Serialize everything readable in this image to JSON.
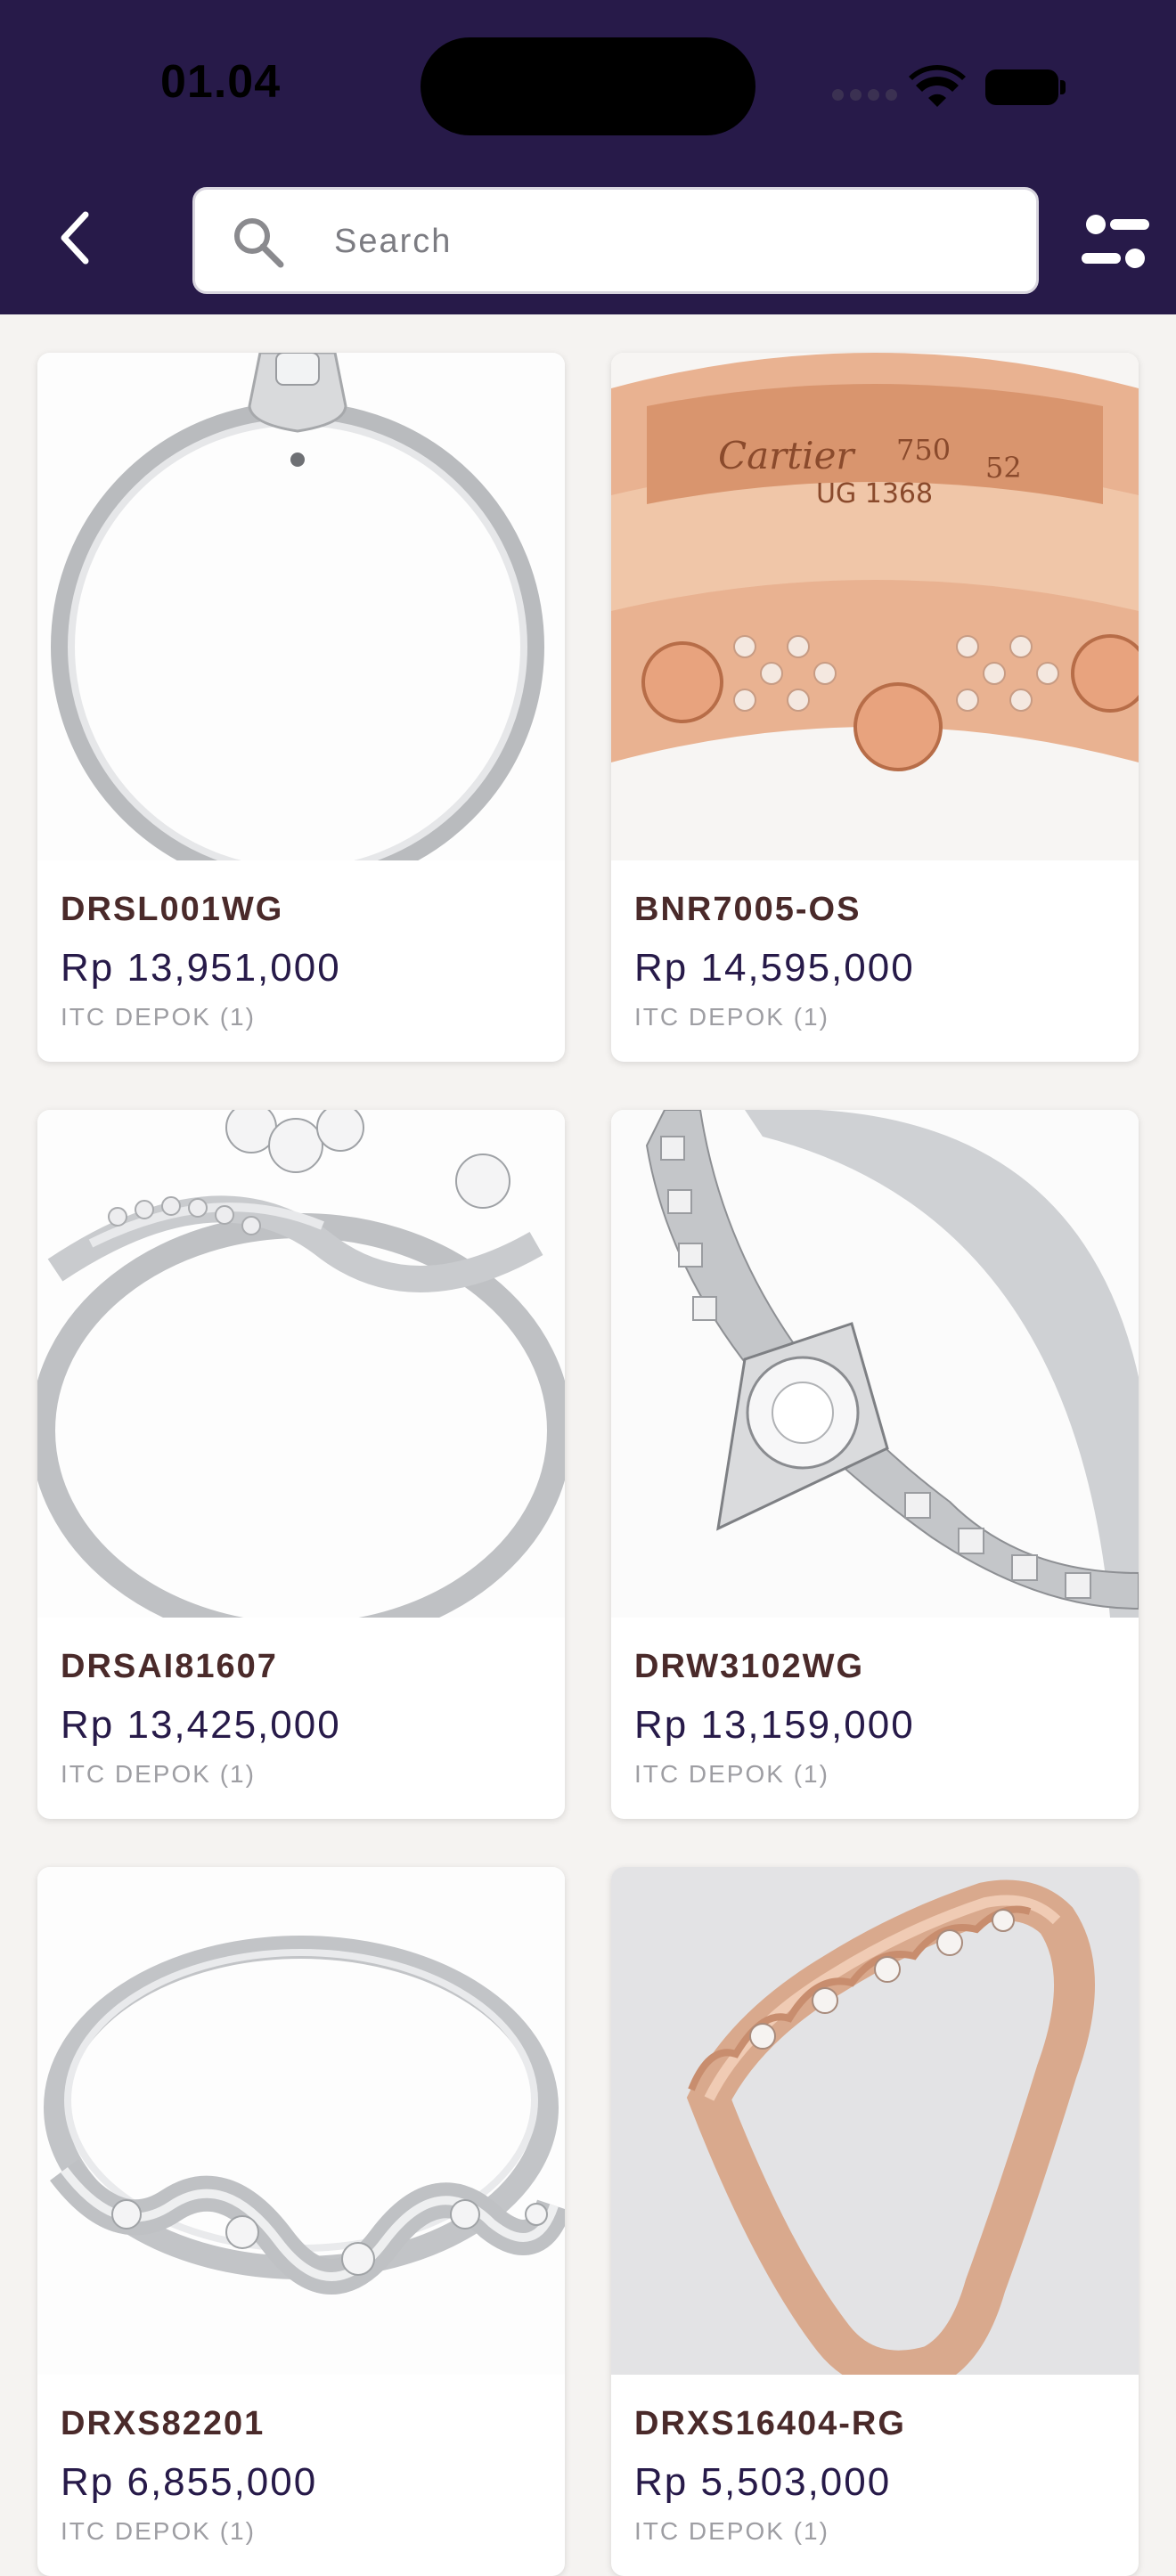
{
  "status_bar": {
    "time": "01.04"
  },
  "search": {
    "placeholder": "Search",
    "value": ""
  },
  "colors": {
    "header_bg": "#271A49",
    "background": "#F5F3F1",
    "product_code": "#4A2A2A",
    "price": "#271A49",
    "store": "#9E9EA3"
  },
  "icons": {
    "back": "chevron-left-icon",
    "search": "search-icon",
    "filter": "filter-icon",
    "wifi": "wifi-icon",
    "battery": "battery-icon"
  },
  "products": [
    {
      "code": "DRSL001WG",
      "price": "Rp 13,951,000",
      "store": "ITC DEPOK (1)"
    },
    {
      "code": "BNR7005-OS",
      "price": "Rp 14,595,000",
      "store": "ITC DEPOK (1)",
      "engraving": {
        "brand": "Cartier",
        "marks": [
          "750",
          "52"
        ],
        "serial": "UG 1368"
      }
    },
    {
      "code": "DRSAI81607",
      "price": "Rp 13,425,000",
      "store": "ITC DEPOK (1)"
    },
    {
      "code": "DRW3102WG",
      "price": "Rp 13,159,000",
      "store": "ITC DEPOK (1)"
    },
    {
      "code": "DRXS82201",
      "price": "Rp 6,855,000",
      "store": "ITC DEPOK (1)"
    },
    {
      "code": "DRXS16404-RG",
      "price": "Rp 5,503,000",
      "store": "ITC DEPOK (1)"
    }
  ]
}
